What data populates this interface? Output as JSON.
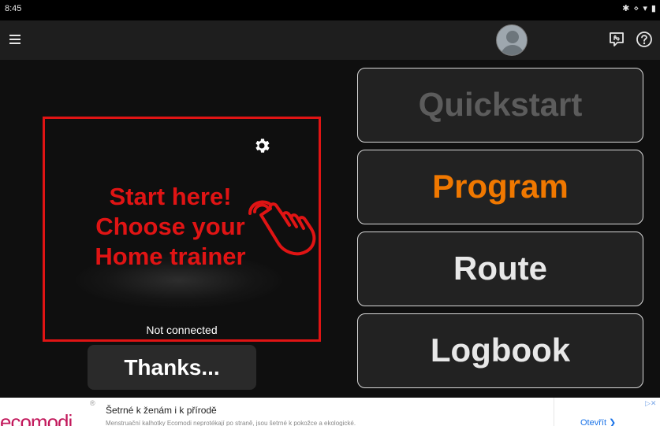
{
  "status_bar": {
    "time": "8:45",
    "icons": "✱ ⋄ ▾ ▮"
  },
  "app_bar": {
    "menu_icon": "menu-icon",
    "avatar_icon": "avatar",
    "chat_icon": "chat-bubble-icon",
    "help_icon": "help-circle-icon"
  },
  "trainer_panel": {
    "line1": "Start here!",
    "line2": "Choose your",
    "line3": "Home trainer",
    "status": "Not connected",
    "accent_color": "#e01414"
  },
  "thanks_button": {
    "label": "Thanks..."
  },
  "menu": {
    "quickstart": "Quickstart",
    "program": "Program",
    "route": "Route",
    "logbook": "Logbook",
    "program_color": "#f07800",
    "quickstart_color": "#5c5c5c"
  },
  "ad": {
    "logo": "ecomodi",
    "registered": "®",
    "title": "Šetrné k ženám i k přírodě",
    "description": "Menstruační kalhotky Ecomodi neprotékají po straně, jsou šetrné k pokožce a ekologické.",
    "cta": "Otevřít ❯",
    "choices": "▷✕"
  }
}
